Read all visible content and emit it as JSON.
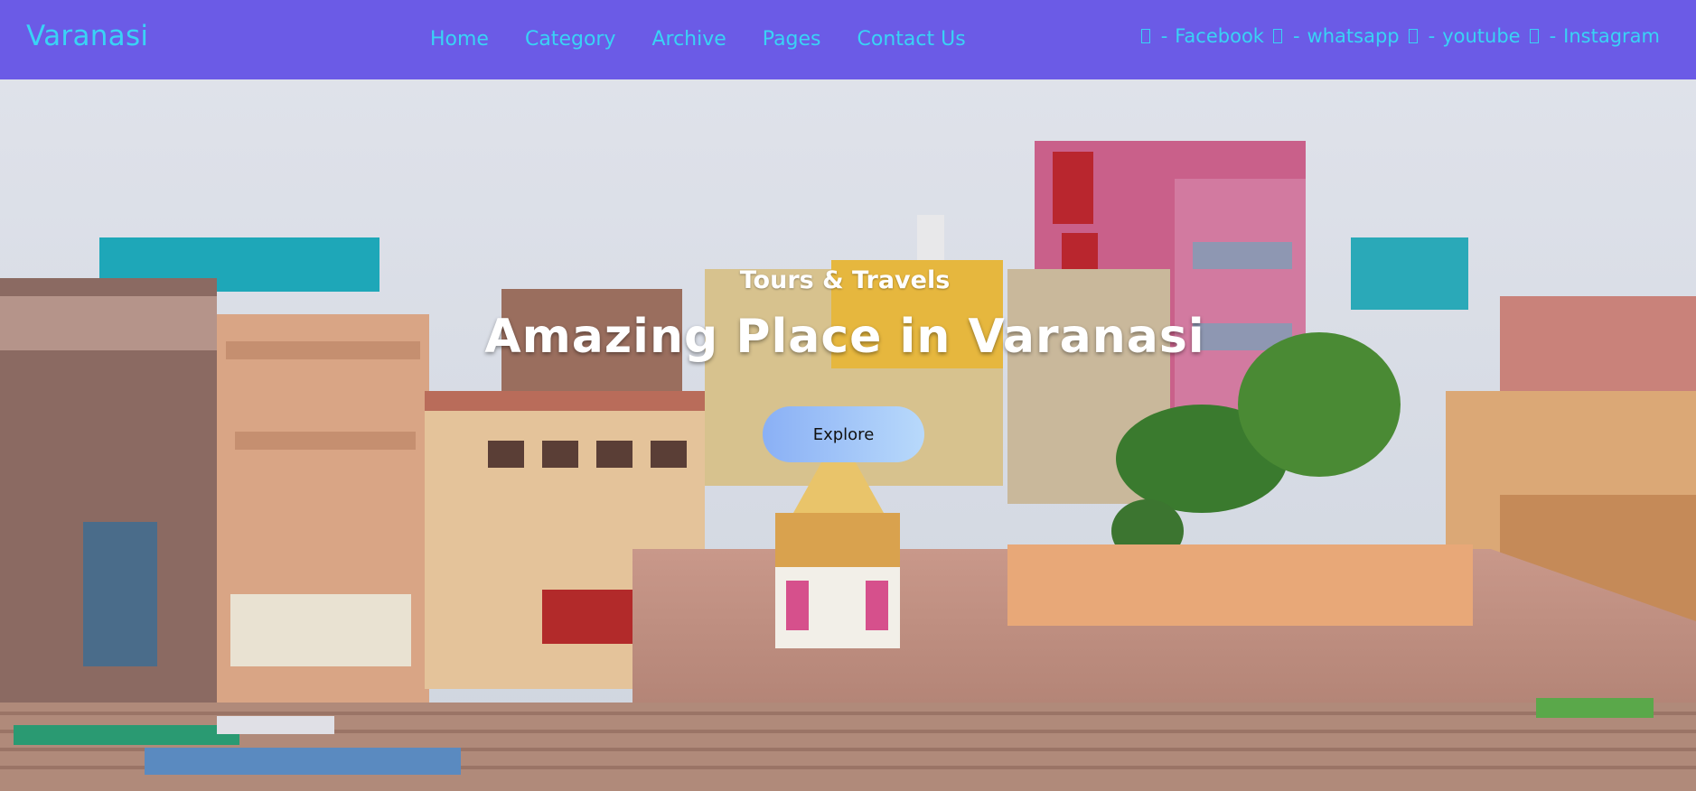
{
  "brand": {
    "name": "Varanasi"
  },
  "nav": {
    "items": [
      {
        "label": "Home"
      },
      {
        "label": "Category"
      },
      {
        "label": "Archive"
      },
      {
        "label": "Pages"
      },
      {
        "label": "Contact Us"
      }
    ]
  },
  "social": {
    "separator": "-",
    "items": [
      {
        "label": "Facebook",
        "icon": "facebook-icon"
      },
      {
        "label": "whatsapp",
        "icon": "whatsapp-icon"
      },
      {
        "label": "youtube",
        "icon": "youtube-icon"
      },
      {
        "label": "Instagram",
        "icon": "instagram-icon"
      }
    ]
  },
  "hero": {
    "subtitle": "Tours & Travels",
    "title": "Amazing Place in Varanasi",
    "cta_label": "Explore"
  },
  "colors": {
    "navbar_bg": "#6b5be6",
    "nav_text": "#39d3f5",
    "hero_text": "#ffffff",
    "button_gradient_start": "#8ab0f5",
    "button_gradient_end": "#b8d9fb"
  }
}
